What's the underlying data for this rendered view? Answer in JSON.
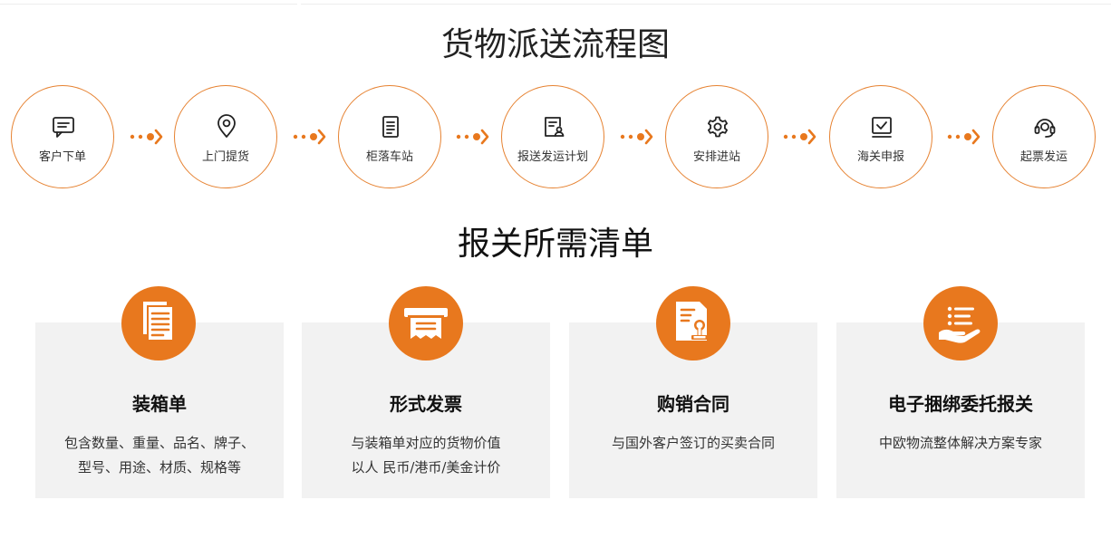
{
  "flow": {
    "title": "货物派送流程图",
    "steps": [
      {
        "label": "客户下单",
        "icon": "chat-icon"
      },
      {
        "label": "上门提货",
        "icon": "location-pin-icon"
      },
      {
        "label": "柜落车站",
        "icon": "document-icon"
      },
      {
        "label": "报送发运计划",
        "icon": "form-person-icon"
      },
      {
        "label": "安排进站",
        "icon": "gear-icon"
      },
      {
        "label": "海关申报",
        "icon": "checkbox-icon"
      },
      {
        "label": "起票发运",
        "icon": "headset-icon"
      }
    ]
  },
  "checklist": {
    "title": "报关所需清单",
    "cards": [
      {
        "title": "装箱单",
        "desc_line1": "包含数量、重量、品名、牌子、",
        "desc_line2": "型号、用途、材质、规格等",
        "icon": "documents-stack-icon"
      },
      {
        "title": "形式发票",
        "desc_line1": "与装箱单对应的货物价值",
        "desc_line2": "以人 民币/港币/美金计价",
        "icon": "receipt-printer-icon"
      },
      {
        "title": "购销合同",
        "desc_line1": "与国外客户签订的买卖合同",
        "desc_line2": "",
        "icon": "contract-seal-icon"
      },
      {
        "title": "电子捆绑委托报关",
        "desc_line1": "中欧物流整体解决方案专家",
        "desc_line2": "",
        "icon": "hand-list-icon"
      }
    ]
  },
  "colors": {
    "accent": "#e8781e",
    "card_bg": "#f2f2f2",
    "circle_border": "#e68231"
  }
}
